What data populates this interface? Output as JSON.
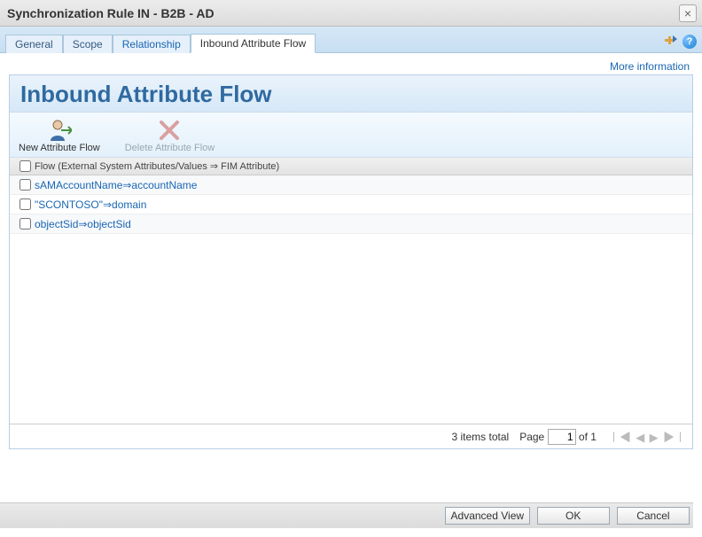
{
  "window": {
    "title": "Synchronization Rule IN - B2B - AD",
    "close_label": "×"
  },
  "tabs": {
    "items": [
      {
        "label": "General",
        "active": false
      },
      {
        "label": "Scope",
        "active": false
      },
      {
        "label": "Relationship",
        "active": false
      },
      {
        "label": "Inbound Attribute Flow",
        "active": true
      }
    ]
  },
  "toolbar_right": {
    "help": "?",
    "add": "➕"
  },
  "links": {
    "more_information": "More information"
  },
  "panel": {
    "heading": "Inbound Attribute Flow"
  },
  "actions": {
    "new_flow": "New Attribute Flow",
    "delete_flow": "Delete Attribute Flow"
  },
  "table": {
    "header": "Flow (External System Attributes/Values ⇒ FIM Attribute)",
    "rows": [
      {
        "text": "sAMAccountName⇒accountName"
      },
      {
        "text": "\"SCONTOSO\"⇒domain"
      },
      {
        "text": "objectSid⇒objectSid"
      }
    ]
  },
  "pager": {
    "total_text": "3 items total",
    "page_label_prefix": "Page",
    "page_value": "1",
    "page_label_suffix": "of 1"
  },
  "buttons": {
    "advanced": "Advanced View",
    "ok": "OK",
    "cancel": "Cancel"
  }
}
